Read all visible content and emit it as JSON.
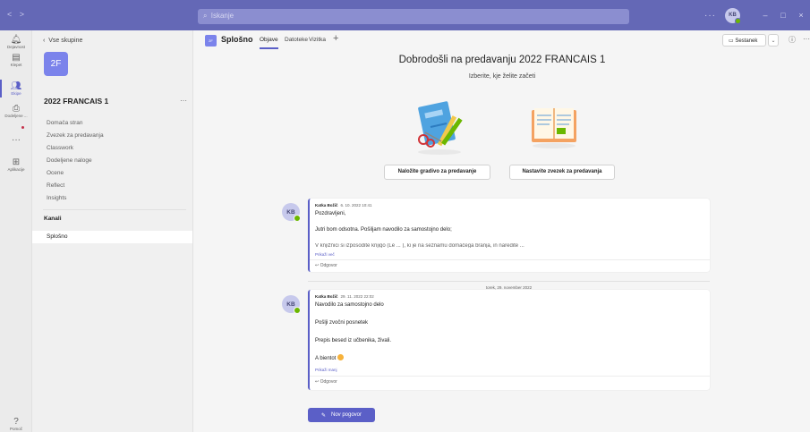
{
  "titlebar": {
    "nav": "< >",
    "search_placeholder": "Iskanje",
    "more": "···",
    "user_initials": "KB",
    "win_min": "–",
    "win_max": "□",
    "win_close": "×"
  },
  "rail": [
    {
      "label": "Dejavnost",
      "icon": "bell-icon",
      "glyph": "🔔︎"
    },
    {
      "label": "Klepet",
      "icon": "chat-icon",
      "glyph": "▤"
    },
    {
      "label": "Ekipe",
      "icon": "teams-icon",
      "glyph": "👥︎"
    },
    {
      "label": "Dodeljene ...",
      "icon": "assignments-icon",
      "glyph": "⎙"
    },
    {
      "label": "",
      "icon": "more-icon",
      "glyph": "···"
    },
    {
      "label": "Aplikacije",
      "icon": "apps-icon",
      "glyph": "⊞"
    },
    {
      "label": "Pomoč",
      "icon": "help-icon",
      "glyph": "?"
    }
  ],
  "sidebar": {
    "back": "Vse skupine",
    "team_logo": "2F",
    "team_name": "2022 FRANCAIS 1",
    "more": "···",
    "nav": [
      "Domača stran",
      "Zvezek za predavanja",
      "Classwork",
      "Dodeljene naloge",
      "Ocene",
      "Reflect",
      "Insights"
    ],
    "channels_header": "Kanali",
    "channels": [
      "Splošno"
    ]
  },
  "header": {
    "channel_logo": "2F",
    "channel_name": "Splošno",
    "tabs": [
      "Objave",
      "Datoteke",
      "Vizitka"
    ],
    "add_tab": "+",
    "meet_label": "Sestanek",
    "meet_chevron": "⌄",
    "info": "ⓘ",
    "more": "···"
  },
  "welcome": {
    "title": "Dobrodošli na predavanju 2022 FRANCAIS 1",
    "subtitle": "Izberite, kje želite začeti",
    "btn_upload": "Naložite gradivo za predavanje",
    "btn_notebook": "Nastavite zvezek za predavanja"
  },
  "messages": [
    {
      "initials": "KB",
      "author": "Katka Božič",
      "time": "6. 10. 2022 10:41",
      "lines": [
        "Pozdravljeni,",
        "Jutri bom odsotna. Pošiljam navodilo za samostojno delo;",
        "V knjižnici si izposodite knjigo (Le ... ), ki je na seznamu domačega branja, in naredite ..."
      ],
      "link": "Prikaži več",
      "reply": "Odgovor"
    },
    {
      "initials": "KB",
      "author": "Katka Božič",
      "time": "29. 11. 2022 22:02",
      "lines": [
        "Navodilo za samostojno delo",
        "Pošlji zvočni posnetek",
        "Prepis besed iz učbenika, živali.",
        "A bientot"
      ],
      "link": "Prikaži manj",
      "reply": "Odgovor"
    }
  ],
  "date_divider": "torek, 29. november 2022",
  "new_post": "Nov pogovor"
}
